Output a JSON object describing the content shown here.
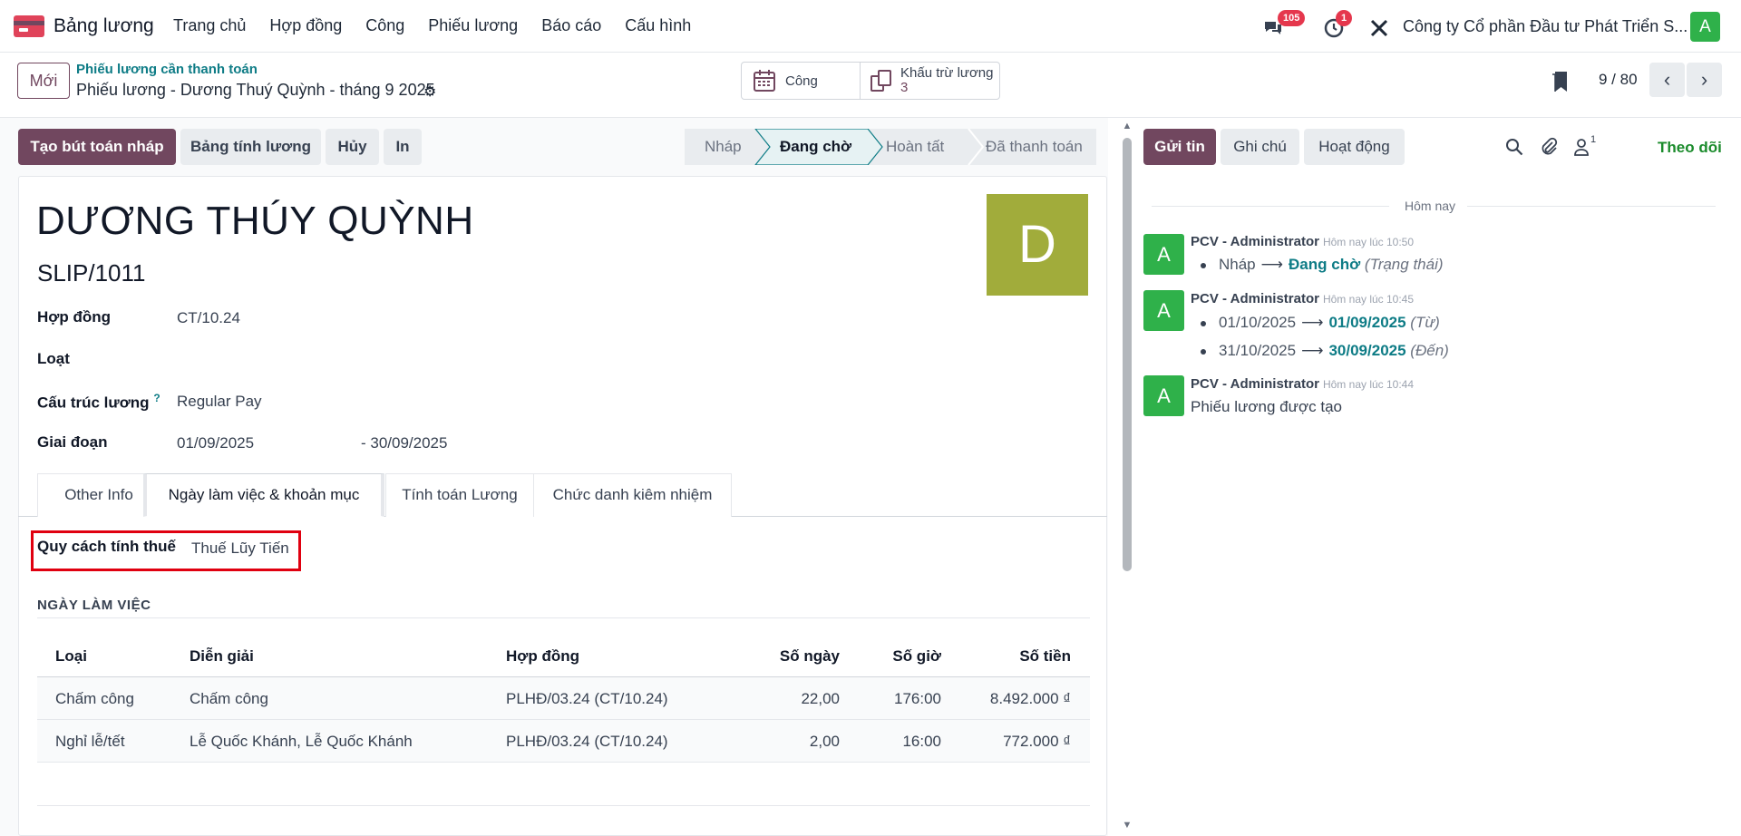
{
  "navbar": {
    "app_name": "Bảng lương",
    "menu": [
      "Trang chủ",
      "Hợp đồng",
      "Công",
      "Phiếu lương",
      "Báo cáo",
      "Cấu hình"
    ],
    "messages_badge": "105",
    "activities_badge": "1",
    "company": "Công ty Cổ phần Đầu tư Phát Triển S...",
    "user_initial": "A"
  },
  "control": {
    "new_label": "Mới",
    "breadcrumb": "Phiếu lương cần thanh toán",
    "record_title": "Phiếu lương - Dương Thuý Quỳnh - tháng 9 2025",
    "smart_buttons": {
      "cong": "Công",
      "khau_tru_label": "Khấu trừ lương",
      "khau_tru_count": "3"
    },
    "pager": "9 / 80"
  },
  "actions": {
    "create_draft": "Tạo bút toán nháp",
    "compute": "Bảng tính lương",
    "cancel": "Hủy",
    "print": "In"
  },
  "status": {
    "stages": [
      "Nháp",
      "Đang chờ",
      "Hoàn tất",
      "Đã thanh toán"
    ],
    "active_index": 1
  },
  "form": {
    "employee_name": "DƯƠNG THÚY QUỲNH",
    "slip_number": "SLIP/1011",
    "avatar_initial": "D",
    "fields": {
      "contract_label": "Hợp đồng",
      "contract_value": "CT/10.24",
      "type_label": "Loạt",
      "structure_label": "Cấu trúc lương",
      "structure_help": "?",
      "structure_value": "Regular Pay",
      "period_label": "Giai đoạn",
      "period_from": "01/09/2025",
      "period_to": "- 30/09/2025"
    },
    "tabs": [
      "Other Info",
      "Ngày làm việc & khoản mục",
      "Tính toán Lương",
      "Chức danh kiêm nhiệm"
    ],
    "active_tab": 1,
    "tax_label": "Quy cách tính thuế",
    "tax_value": "Thuế Lũy Tiến",
    "worked_days_title": "NGÀY LÀM VIỆC",
    "table": {
      "headers": [
        "Loại",
        "Diễn giải",
        "Hợp đồng",
        "Số ngày",
        "Số giờ",
        "Số tiền"
      ],
      "rows": [
        [
          "Chấm công",
          "Chấm công",
          "PLHĐ/03.24 (CT/10.24)",
          "22,00",
          "176:00",
          "8.492.000 ₫"
        ],
        [
          "Nghỉ lễ/tết",
          "Lễ Quốc Khánh, Lễ Quốc Khánh",
          "PLHĐ/03.24 (CT/10.24)",
          "2,00",
          "16:00",
          "772.000 ₫"
        ]
      ]
    }
  },
  "chatter": {
    "send_message": "Gửi tin",
    "log_note": "Ghi chú",
    "activities": "Hoạt động",
    "followers_count": "1",
    "follow": "Theo dõi",
    "date_separator": "Hôm nay",
    "messages": [
      {
        "author": "PCV - Administrator",
        "time": "Hôm nay lúc 10:50",
        "tracking": [
          {
            "old": "Nháp",
            "new": "Đang chờ",
            "field": "(Trạng thái)"
          }
        ]
      },
      {
        "author": "PCV - Administrator",
        "time": "Hôm nay lúc 10:45",
        "tracking": [
          {
            "old": "01/10/2025",
            "new": "01/09/2025",
            "field": "(Từ)"
          },
          {
            "old": "31/10/2025",
            "new": "30/09/2025",
            "field": "(Đến)"
          }
        ]
      },
      {
        "author": "PCV - Administrator",
        "time": "Hôm nay lúc 10:44",
        "body": "Phiếu lương được tạo"
      }
    ],
    "avatar_initial": "A"
  }
}
